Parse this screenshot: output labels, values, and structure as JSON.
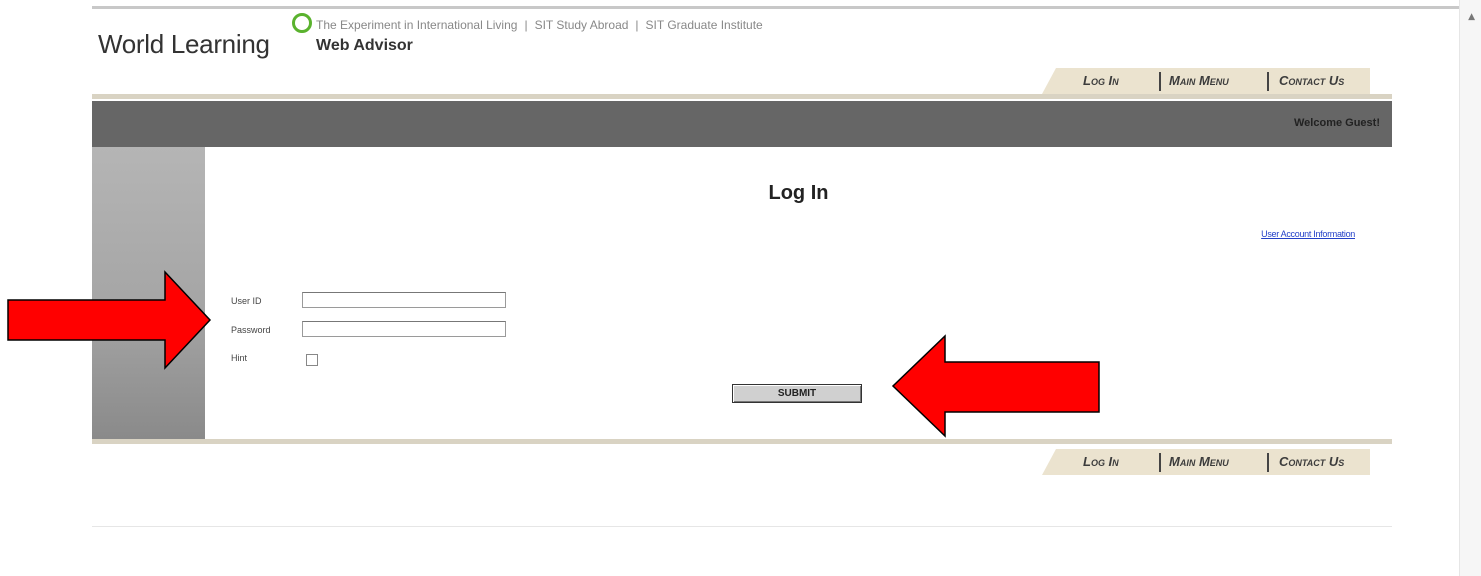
{
  "header": {
    "logo_text": "World Learning",
    "sublinks": [
      "The Experiment in International Living",
      "SIT Study Abroad",
      "SIT Graduate Institute"
    ],
    "separator": "|",
    "app_name": "Web Advisor"
  },
  "nav": {
    "items": [
      "Log In",
      "Main Menu",
      "Contact Us"
    ]
  },
  "banner": {
    "welcome": "Welcome Guest!"
  },
  "form": {
    "title": "Log In",
    "account_link": "User Account Information",
    "userid_label": "User ID",
    "userid_value": "",
    "password_label": "Password",
    "password_value": "",
    "hint_label": "Hint",
    "hint_checked": false,
    "submit_label": "SUBMIT"
  },
  "annotations": {
    "arrow_color": "#ff0000"
  },
  "colors": {
    "brand_green": "#5ab22e",
    "nav_tab": "#ebe3cf",
    "dark_band": "#666666",
    "link": "#2340c8"
  }
}
